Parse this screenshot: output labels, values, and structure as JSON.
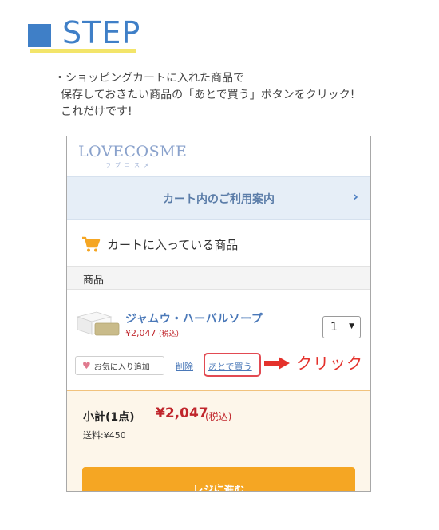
{
  "header": {
    "title": "STEP"
  },
  "intro": {
    "lines": [
      "・ショッピングカートに入れた商品で",
      "保存しておきたい商品の「あとで買う」ボタンをクリック!",
      "これだけです!"
    ]
  },
  "site": {
    "brand": "LOVECOSME",
    "brand_sub": "ラブコスメ"
  },
  "guide": {
    "label": "カート内のご利用案内"
  },
  "cart": {
    "title": "カートに入っている商品",
    "section": "商品"
  },
  "product": {
    "name": "ジャムウ・ハーバルソープ",
    "price": "¥2,047",
    "tax_note": "(税込)",
    "quantity": "1"
  },
  "actions": {
    "favorite": "お気に入り追加",
    "delete": "削除",
    "later": "あとで買う"
  },
  "annotation": {
    "label": "クリック"
  },
  "summary": {
    "subtotal_label": "小計(1点)",
    "subtotal_value": "¥2,047",
    "subtotal_tax": "(税込)",
    "shipping": "送料:¥450"
  },
  "checkout": {
    "label": "レジに進む"
  },
  "colors": {
    "accent": "#3f7fc7",
    "highlight": "#e24a52",
    "price": "#c0262c",
    "checkout": "#f5a623"
  }
}
